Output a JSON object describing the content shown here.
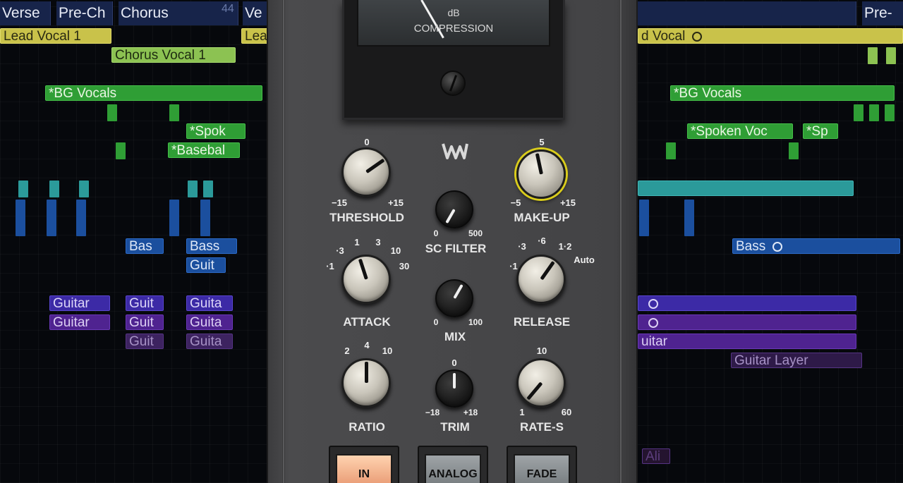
{
  "daw": {
    "markers": [
      {
        "label": "Verse"
      },
      {
        "label": "Pre-Ch"
      },
      {
        "label": "Chorus"
      },
      {
        "label": "Ve"
      },
      {
        "label": "Pre-"
      }
    ],
    "marker_number": "44",
    "regions": {
      "lead_vocal_1": "Lead Vocal 1",
      "lead_vocal_2": "Lea",
      "lead_vocal_right": "d Vocal",
      "chorus_vocal_1": "Chorus Vocal 1",
      "bg_vocals_left": "*BG Vocals",
      "bg_vocals_right": "*BG Vocals",
      "spok_left": "*Spok",
      "spoken_voc_right": "*Spoken Voc",
      "sp_right": "*Sp",
      "baseball": "*Basebal",
      "bas_1": "Bas",
      "bass_2": "Bass",
      "bass_right": "Bass",
      "guit_1": "Guit",
      "guitar_a": "Guitar",
      "guit_a2": "Guit",
      "guita_a3": "Guita",
      "guitar_b": "Guitar",
      "guit_b2": "Guit",
      "guita_b3": "Guita",
      "guit_c2": "Guit",
      "guita_c3": "Guita",
      "uitar_right": "uitar",
      "guitar_layer": "Guitar Layer",
      "ali": "Ali"
    }
  },
  "plugin": {
    "meter": {
      "unit": "dB",
      "label": "COMPRESSION"
    },
    "threshold": {
      "name": "THRESHOLD",
      "top": "0",
      "min": "−15",
      "max": "+15"
    },
    "makeup": {
      "name": "MAKE-UP",
      "top": "5",
      "min": "−5",
      "max": "+15"
    },
    "sc_filter": {
      "name": "SC FILTER",
      "min": "0",
      "max": "500"
    },
    "mix": {
      "name": "MIX",
      "min": "0",
      "max": "100"
    },
    "trim": {
      "name": "TRIM",
      "top": "0",
      "min": "−18",
      "max": "+18"
    },
    "attack": {
      "name": "ATTACK",
      "t1": "·3",
      "t2": "1",
      "t3": "3",
      "t4": "10",
      "t5": "30",
      "t0": "·1"
    },
    "release": {
      "name": "RELEASE",
      "t0": "·1",
      "t1": "·3",
      "t2": "·6",
      "t3": "1·2",
      "t4": "Auto"
    },
    "ratio": {
      "name": "RATIO",
      "t1": "2",
      "t2": "4",
      "t3": "10"
    },
    "rate_s": {
      "name": "RATE-S",
      "top": "10",
      "min": "1",
      "max": "60"
    },
    "buttons": {
      "in": "IN",
      "analog": "ANALOG",
      "fade": "FADE"
    },
    "colors": {
      "selection": "#d9cc1c",
      "in_button": "#f0b48a",
      "panel": "#474749"
    }
  }
}
